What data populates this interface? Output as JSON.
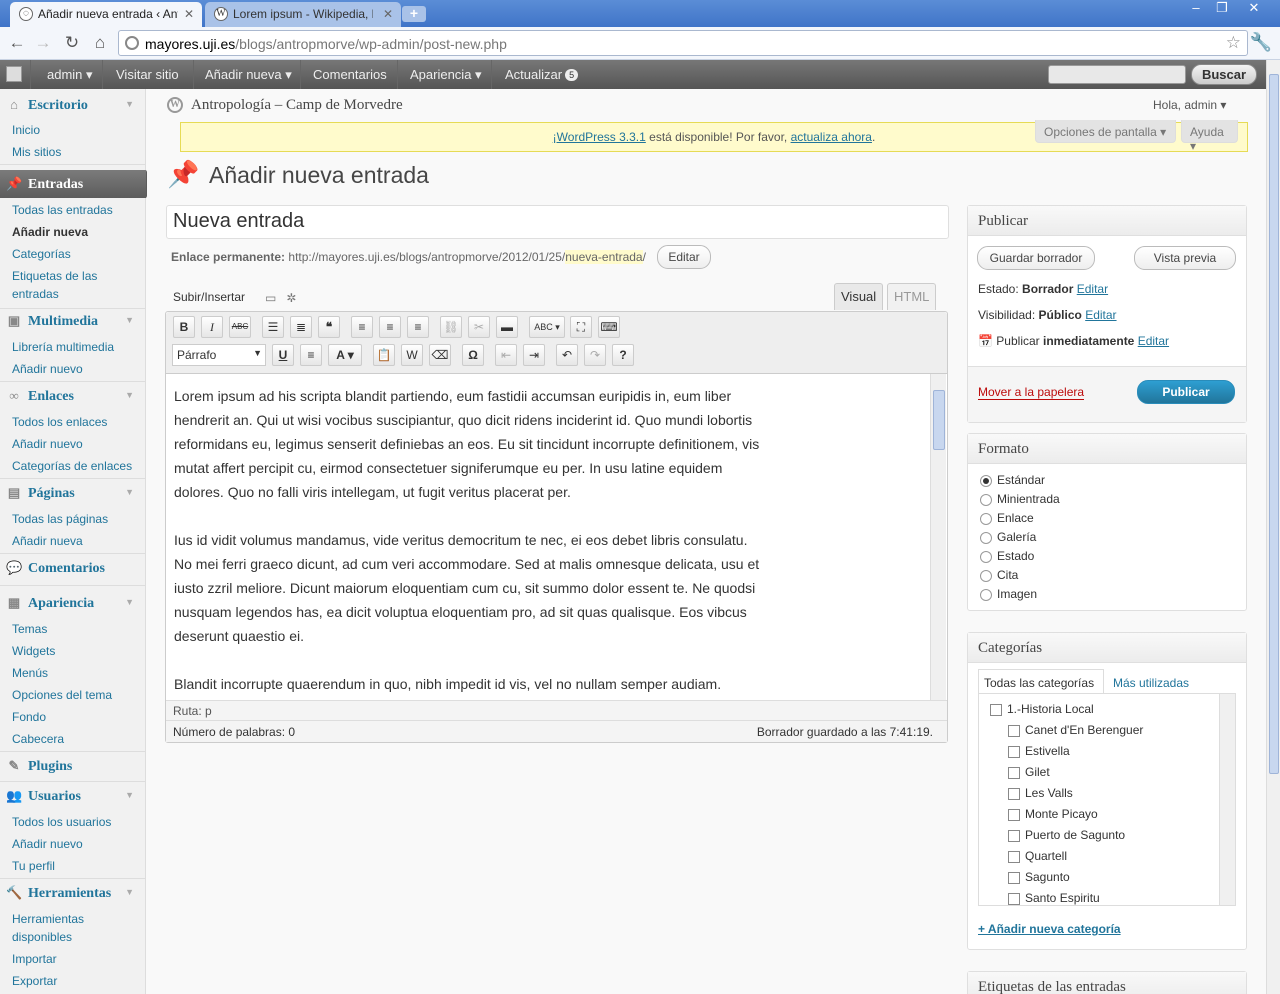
{
  "browser": {
    "tabs": [
      {
        "title": "Añadir nueva entrada ‹ Antropo"
      },
      {
        "title": "Lorem ipsum - Wikipedia, la en"
      }
    ],
    "url_host": "mayores.uji.es",
    "url_path": "/blogs/antropmorve/wp-admin/post-new.php"
  },
  "adminbar": {
    "user": "admin",
    "visit": "Visitar sitio",
    "add_new": "Añadir nueva",
    "comments": "Comentarios",
    "appearance": "Apariencia",
    "update": "Actualizar",
    "update_count": "5",
    "search_button": "Buscar"
  },
  "sidebar": {
    "dashboard": {
      "label": "Escritorio",
      "items": [
        "Inicio",
        "Mis sitios"
      ]
    },
    "posts": {
      "label": "Entradas",
      "items": [
        "Todas las entradas",
        "Añadir nueva",
        "Categorías",
        "Etiquetas de las entradas"
      ]
    },
    "media": {
      "label": "Multimedia",
      "items": [
        "Librería multimedia",
        "Añadir nuevo"
      ]
    },
    "links": {
      "label": "Enlaces",
      "items": [
        "Todos los enlaces",
        "Añadir nuevo",
        "Categorías de enlaces"
      ]
    },
    "pages": {
      "label": "Páginas",
      "items": [
        "Todas las páginas",
        "Añadir nueva"
      ]
    },
    "comments": {
      "label": "Comentarios"
    },
    "appearance": {
      "label": "Apariencia",
      "items": [
        "Temas",
        "Widgets",
        "Menús",
        "Opciones del tema",
        "Fondo",
        "Cabecera"
      ]
    },
    "plugins": {
      "label": "Plugins"
    },
    "users": {
      "label": "Usuarios",
      "items": [
        "Todos los usuarios",
        "Añadir nuevo",
        "Tu perfil"
      ]
    },
    "tools": {
      "label": "Herramientas",
      "items": [
        "Herramientas disponibles",
        "Importar",
        "Exportar"
      ]
    }
  },
  "header": {
    "site_title": "Antropología – Camp de Morvedre",
    "howdy": "Hola, admin",
    "screen_options": "Opciones de pantalla",
    "help": "Ayuda"
  },
  "notice": {
    "link1": "¡WordPress 3.3.1",
    "text": " está disponible! Por favor, ",
    "link2": "actualiza ahora",
    "end": "."
  },
  "page": {
    "title": "Añadir nueva entrada",
    "post_title": "Nueva entrada",
    "permalink_label": "Enlace permanente:",
    "permalink_base": "http://mayores.uji.es/blogs/antropmorve/2012/01/25/",
    "permalink_slug": "nueva-entrada",
    "permalink_end": "/",
    "edit_button": "Editar",
    "upload_insert": "Subir/Insertar",
    "tab_visual": "Visual",
    "tab_html": "HTML",
    "format_select": "Párrafo"
  },
  "editor": {
    "paragraphs": [
      "Lorem ipsum ad his scripta blandit partiendo, eum fastidii accumsan euripidis in, eum liber hendrerit an. Qui ut wisi vocibus suscipiantur, quo dicit ridens inciderint id. Quo mundi lobortis reformidans eu, legimus senserit definiebas an eos. Eu sit tincidunt incorrupte definitionem, vis mutat affert percipit cu, eirmod consectetuer signiferumque eu per. In usu latine equidem dolores. Quo no falli viris intellegam, ut fugit veritus placerat per.",
      "Ius id vidit volumus mandamus, vide veritus democritum te nec, ei eos debet libris consulatu. No mei ferri graeco dicunt, ad cum veri accommodare. Sed at malis omnesque delicata, usu et iusto zzril meliore. Dicunt maiorum eloquentiam cum cu, sit summo dolor essent te. Ne quodsi nusquam legendos has, ea dicit voluptua eloquentiam pro, ad sit quas qualisque. Eos vibcus deserunt quaestio ei.",
      "Blandit incorrupte quaerendum in quo, nibh impedit id vis, vel no nullam semper audiam."
    ],
    "path": "Ruta: p",
    "word_count": "Número de palabras: 0",
    "saved": "Borrador guardado a las 7:41:19."
  },
  "publish": {
    "title": "Publicar",
    "save_draft": "Guardar borrador",
    "preview": "Vista previa",
    "status_label": "Estado:",
    "status_value": "Borrador",
    "visibility_label": "Visibilidad:",
    "visibility_value": "Público",
    "publish_label": "Publicar",
    "publish_value": "inmediatamente",
    "edit": "Editar",
    "trash": "Mover a la papelera",
    "publish_button": "Publicar"
  },
  "format": {
    "title": "Formato",
    "options": [
      "Estándar",
      "Minientrada",
      "Enlace",
      "Galería",
      "Estado",
      "Cita",
      "Imagen"
    ],
    "selected": 0
  },
  "categories": {
    "title": "Categorías",
    "tab_all": "Todas las categorías",
    "tab_popular": "Más utilizadas",
    "parent": "1.-Historia Local",
    "children": [
      "Canet d'En Berenguer",
      "Estivella",
      "Gilet",
      "Les Valls",
      "Monte Picayo",
      "Puerto de Sagunto",
      "Quartell",
      "Sagunto",
      "Santo Espiritu"
    ],
    "add_new": "+ Añadir nueva categoría"
  },
  "tags_box": {
    "title": "Etiquetas de las entradas"
  }
}
